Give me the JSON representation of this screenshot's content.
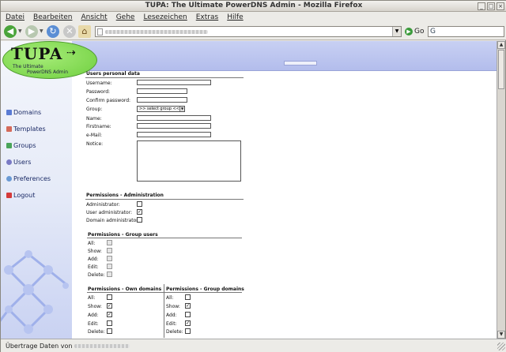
{
  "window": {
    "title": "TUPA: The Ultimate PowerDNS Admin - Mozilla Firefox"
  },
  "menu": [
    "Datei",
    "Bearbeiten",
    "Ansicht",
    "Gehe",
    "Lesezeichen",
    "Extras",
    "Hilfe"
  ],
  "toolbar": {
    "go_label": "Go",
    "icons": [
      "back-icon",
      "forward-icon",
      "reload-icon",
      "stop-icon",
      "home-icon"
    ]
  },
  "logo": {
    "word": "TUPA",
    "tagline_1": "The Ultimate",
    "tagline_2": "PowerDNS Admin"
  },
  "nav": [
    {
      "label": "Domains",
      "icon": "domains-icon",
      "color": "#5a7bd4"
    },
    {
      "label": "Templates",
      "icon": "templates-icon",
      "color": "#d46a5a"
    },
    {
      "label": "Groups",
      "icon": "groups-icon",
      "color": "#4aa45a"
    },
    {
      "label": "Users",
      "icon": "users-icon",
      "color": "#7a7ac4"
    },
    {
      "label": "Preferences",
      "icon": "preferences-icon",
      "color": "#6a9ad4"
    },
    {
      "label": "Logout",
      "icon": "logout-icon",
      "color": "#d43a3a"
    }
  ],
  "form": {
    "personal": {
      "title": "Users personal data",
      "username_label": "Username:",
      "password_label": "Password:",
      "confirm_label": "Confirm password:",
      "group_label": "Group:",
      "group_selected": ">> select group <<",
      "name_label": "Name:",
      "firstname_label": "Firstname:",
      "email_label": "e-Mail:",
      "notice_label": "Notice:"
    },
    "admin": {
      "title": "Permissions - Administration",
      "items": [
        {
          "label": "Administrator:",
          "checked": false
        },
        {
          "label": "User administrator:",
          "checked": true
        },
        {
          "label": "Domain administrator:",
          "checked": false
        }
      ]
    },
    "group_users": {
      "title": "Permissions - Group users",
      "items": [
        {
          "label": "All:",
          "checked": false
        },
        {
          "label": "Show:",
          "checked": false
        },
        {
          "label": "Add:",
          "checked": false
        },
        {
          "label": "Edit:",
          "checked": false
        },
        {
          "label": "Delete:",
          "checked": false
        }
      ]
    },
    "own_domains": {
      "title": "Permissions - Own domains",
      "items": [
        {
          "label": "All:",
          "checked": false
        },
        {
          "label": "Show:",
          "checked": true
        },
        {
          "label": "Add:",
          "checked": true
        },
        {
          "label": "Edit:",
          "checked": false
        },
        {
          "label": "Delete:",
          "checked": false
        }
      ]
    },
    "group_domains": {
      "title": "Permissions - Group domains",
      "items": [
        {
          "label": "All:",
          "checked": false
        },
        {
          "label": "Show:",
          "checked": true
        },
        {
          "label": "Add:",
          "checked": false
        },
        {
          "label": "Edit:",
          "checked": true
        },
        {
          "label": "Delete:",
          "checked": false
        }
      ]
    }
  },
  "status": {
    "text": "Übertrage Daten von"
  }
}
